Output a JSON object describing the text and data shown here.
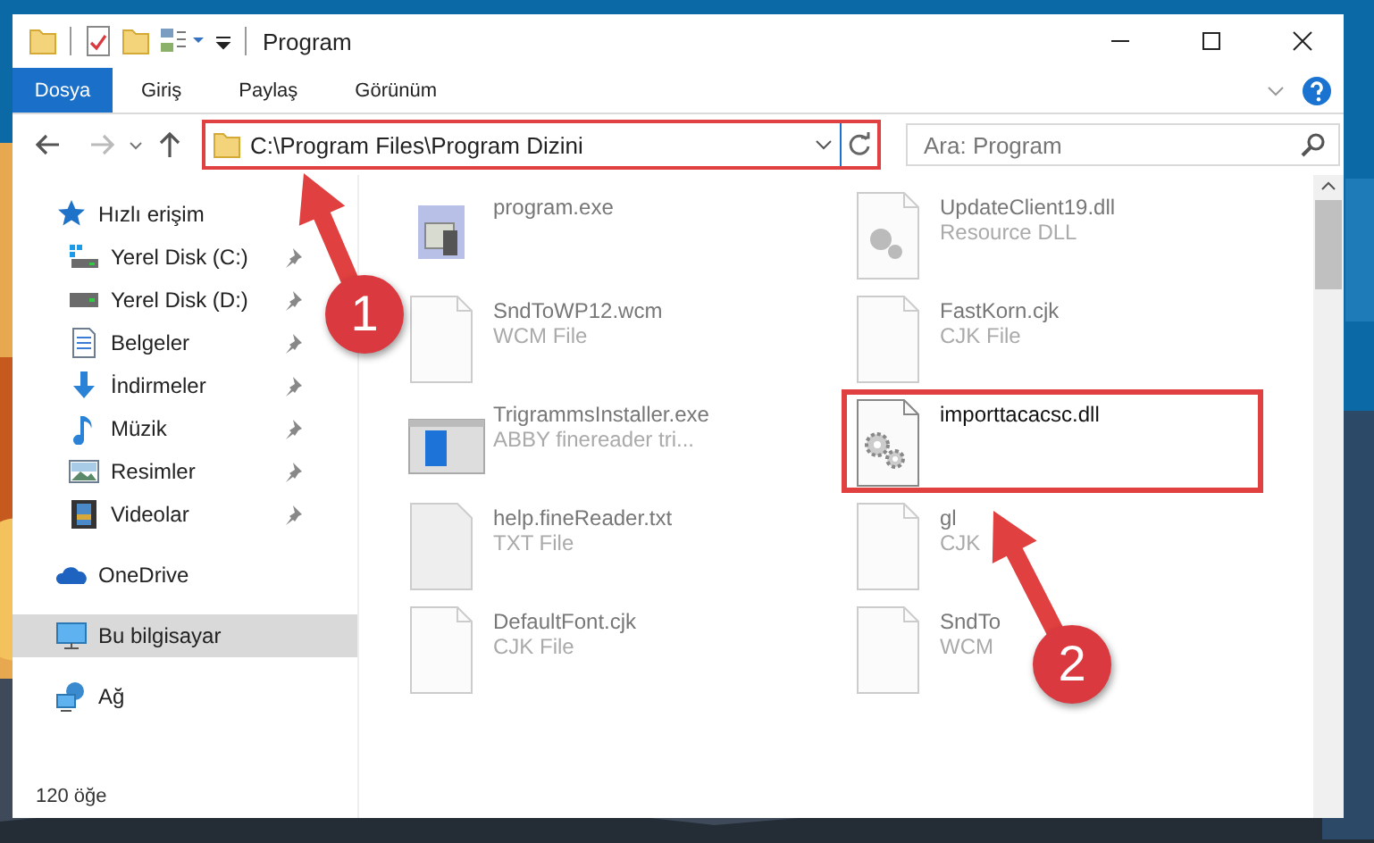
{
  "window": {
    "title": "Program"
  },
  "ribbon_tabs": [
    {
      "label": "Dosya",
      "selected": true
    },
    {
      "label": "Giriş",
      "selected": false
    },
    {
      "label": "Paylaş",
      "selected": false
    },
    {
      "label": "Görünüm",
      "selected": false
    }
  ],
  "address_bar": {
    "path": "C:\\Program Files\\Program Dizini",
    "highlighted": true
  },
  "search": {
    "placeholder": "Ara: Program"
  },
  "sidebar": {
    "items": [
      {
        "label": "Hızlı erişim",
        "kind": "star",
        "selected": false,
        "children": [
          {
            "label": "Yerel Disk (C:)",
            "kind": "drive-windows",
            "pinned": true,
            "selected": false
          },
          {
            "label": "Yerel Disk (D:)",
            "kind": "drive",
            "pinned": true,
            "selected": false
          },
          {
            "label": "Belgeler",
            "kind": "document",
            "pinned": true,
            "selected": false
          },
          {
            "label": "İndirmeler",
            "kind": "download",
            "pinned": true,
            "selected": false
          },
          {
            "label": "Müzik",
            "kind": "music",
            "pinned": true,
            "selected": false
          },
          {
            "label": "Resimler",
            "kind": "pictures",
            "pinned": true,
            "selected": false
          },
          {
            "label": "Videolar",
            "kind": "video",
            "pinned": true,
            "selected": false
          }
        ]
      },
      {
        "label": "OneDrive",
        "kind": "cloud",
        "selected": false
      },
      {
        "label": "Bu bilgisayar",
        "kind": "computer",
        "selected": true
      },
      {
        "label": "Ağ",
        "kind": "network",
        "selected": false
      }
    ]
  },
  "files": [
    {
      "name": "program.exe",
      "kind": "exe",
      "highlighted": false
    },
    {
      "name": "UpdateClient19.dll",
      "type": "Resource DLL",
      "kind": "dll-search",
      "highlighted": false
    },
    {
      "name": "SndToWP12.wcm",
      "type": "WCM File",
      "kind": "blank",
      "highlighted": false
    },
    {
      "name": "FastKorn.cjk",
      "type": "CJK File",
      "kind": "blank",
      "highlighted": false
    },
    {
      "name": "TrigrammsInstaller.exe",
      "type": "ABBY finereader tri...",
      "kind": "installer",
      "highlighted": false
    },
    {
      "name": "importtacacsc.dll",
      "kind": "dll-gear",
      "highlighted": true
    },
    {
      "name": "help.fineReader.txt",
      "type": "TXT File",
      "kind": "text",
      "highlighted": false
    },
    {
      "name": "gl",
      "type": "CJK",
      "kind": "blank",
      "highlighted": false
    },
    {
      "name": "DefaultFont.cjk",
      "type": "CJK File",
      "kind": "blank",
      "highlighted": false
    },
    {
      "name": "SndTo",
      "type": "WCM",
      "kind": "blank",
      "highlighted": false
    }
  ],
  "status_bar": {
    "item_count": "120 öğe"
  },
  "callouts": [
    {
      "label": "1"
    },
    {
      "label": "2"
    }
  ]
}
